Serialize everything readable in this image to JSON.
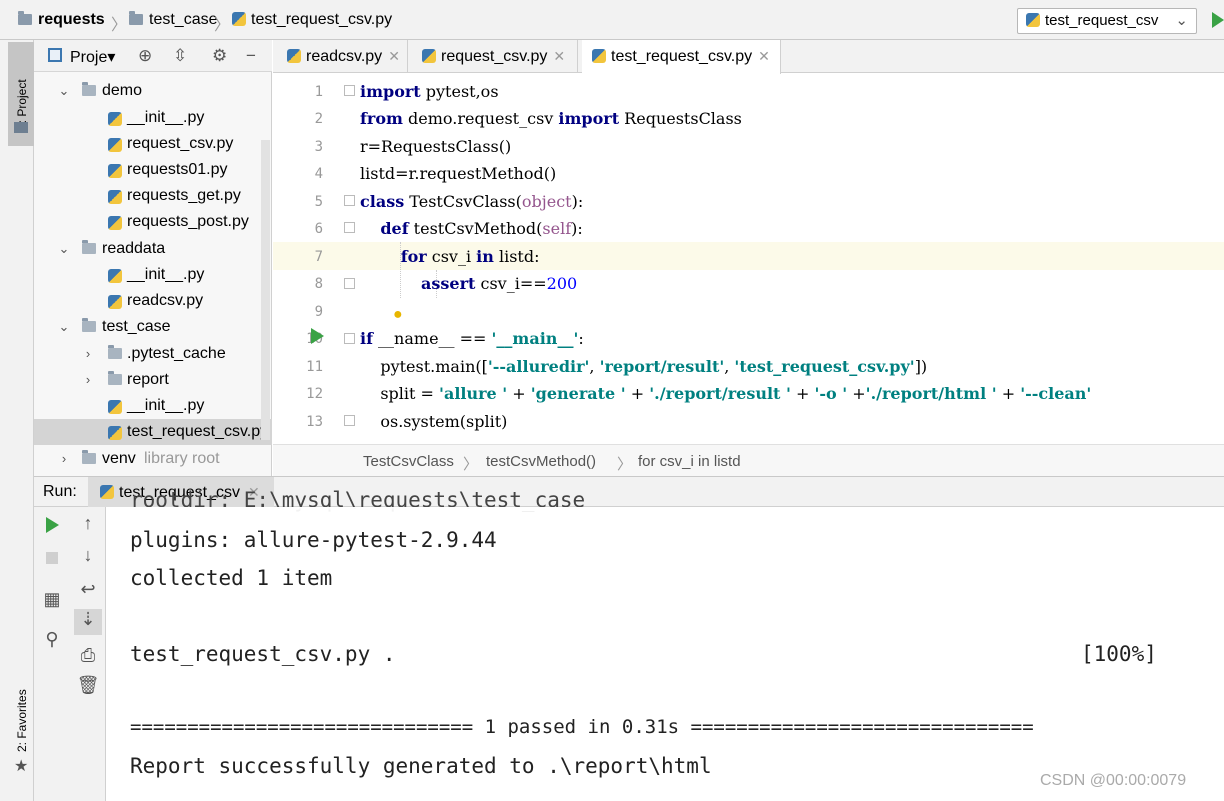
{
  "navbar": {
    "project": "requests",
    "folder": "test_case",
    "file": "test_request_csv.py",
    "run_config": "test_request_csv"
  },
  "tool_windows": {
    "project_tab": "1: Project",
    "favorites_tab": "2: Favorites"
  },
  "project_panel": {
    "title": "Proje",
    "tree": [
      {
        "label": "demo",
        "kind": "folder",
        "expanded": true
      },
      {
        "label": "__init__.py",
        "kind": "py"
      },
      {
        "label": "request_csv.py",
        "kind": "py"
      },
      {
        "label": "requests01.py",
        "kind": "py"
      },
      {
        "label": "requests_get.py",
        "kind": "py"
      },
      {
        "label": "requests_post.py",
        "kind": "py"
      },
      {
        "label": "readdata",
        "kind": "folder",
        "expanded": true
      },
      {
        "label": "__init__.py",
        "kind": "py"
      },
      {
        "label": "readcsv.py",
        "kind": "py"
      },
      {
        "label": "test_case",
        "kind": "folder",
        "expanded": true
      },
      {
        "label": ".pytest_cache",
        "kind": "folder",
        "expanded": false
      },
      {
        "label": "report",
        "kind": "folder",
        "expanded": false
      },
      {
        "label": "__init__.py",
        "kind": "py"
      },
      {
        "label": "test_request_csv.py",
        "kind": "py",
        "selected": true
      },
      {
        "label": "venv",
        "kind": "folder",
        "expanded": false,
        "suffix": "library root"
      }
    ]
  },
  "editor_tabs": [
    {
      "label": "readcsv.py",
      "active": false
    },
    {
      "label": "request_csv.py",
      "active": false
    },
    {
      "label": "test_request_csv.py",
      "active": true
    }
  ],
  "editor": {
    "line_numbers": [
      "1",
      "2",
      "3",
      "4",
      "5",
      "6",
      "7",
      "8",
      "9",
      "10",
      "11",
      "12",
      "13"
    ],
    "current_line": 7
  },
  "editor_breadcrumbs": [
    "TestCsvClass",
    "testCsvMethod()",
    "for csv_i in listd"
  ],
  "run_panel": {
    "label": "Run:",
    "tab": "test_request_csv",
    "output": [
      "rootdir: E:\\mysql\\requests\\test_case",
      "plugins: allure-pytest-2.9.44",
      "collected 1 item",
      "",
      "test_request_csv.py .",
      "",
      "============================== 1 passed in 0.31s ==============================",
      "Report successfully generated to .\\report\\html"
    ],
    "progress": "[100%]"
  },
  "watermark": "CSDN @00:00:0079",
  "colors": {
    "keyword": "#000080",
    "string": "#008080",
    "number": "#0000ff",
    "self": "#94558d",
    "run_green": "#3aa245",
    "current_line": "#fcfae9"
  }
}
